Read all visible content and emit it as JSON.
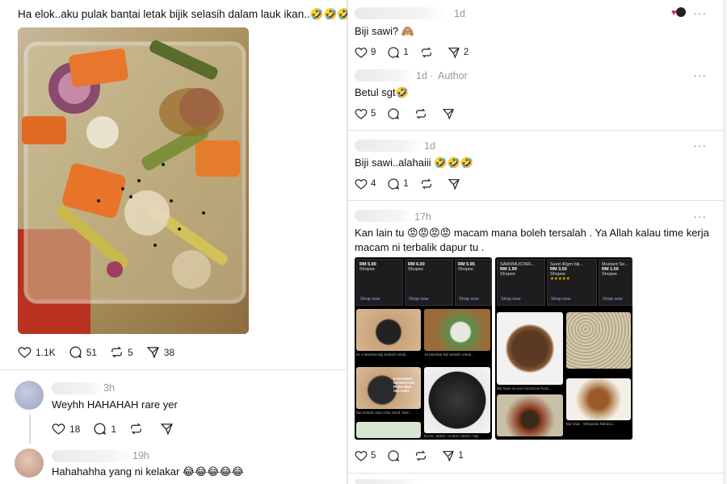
{
  "post": {
    "text": "Ha elok..aku pulak bantai letak bijik selasih dalam lauk ikan..🤣🤣🤣",
    "likes": "1.1K",
    "replies": "51",
    "reposts": "5",
    "shares": "38"
  },
  "left_replies": [
    {
      "time": "3h",
      "text": "Weyhh HAHAHAH rare yer",
      "likes": "18",
      "replies": "1"
    },
    {
      "time": "19h",
      "text": "Hahahahha yang ni kelakar 😂😂😂😂😂"
    }
  ],
  "right_comments": [
    {
      "time": "1d",
      "text": "Biji sawi? 🙈",
      "likes": "9",
      "replies": "1",
      "shares": "2"
    },
    {
      "time": "1d",
      "author_tag": "Author",
      "text": "Betul sgt🤣",
      "likes": "5"
    },
    {
      "time": "1d",
      "text": "Biji sawi..alahaiii 🤣🤣🤣",
      "likes": "4",
      "replies": "1"
    },
    {
      "time": "17h",
      "text_line1": "Kan lain tu 😡😡😡😡 macam mana boleh tersalah . Ya Allah kalau time kerja",
      "text_line2": "macam ni terbalik dapur tu .",
      "likes": "5",
      "shares": "1"
    }
  ],
  "screenshot1": {
    "prices": [
      "RM 5.90",
      "RM 6.00",
      "RM 5.95"
    ],
    "store": "Shopee",
    "shop_now": "Shop now",
    "captions": [
      "ini 4 Manfaat Biji Selasih untuk...",
      "15 Manfaat Biji Selasih untuk...",
      "Biji Selasih atau Chia Seed: Men...",
      "BASIL SEED / SABJA SEED / Biji..."
    ],
    "banner": "8 KHASIAT KESIHATAN PADA BIJI SELASIH"
  },
  "screenshot2": {
    "titles": [
      "SAWI/MUSTAR...",
      "Seed 40gm biji...",
      "Mustard Se..."
    ],
    "prices": [
      "RM 1.99",
      "RM 3.50",
      "RM 1.50"
    ],
    "store": "Shopee",
    "shop_now": "Shop now",
    "captions": [
      "Biji Sawi as your functional food...",
      "Biji Sawi - Wikipedia Bahasa..."
    ]
  },
  "colors": {
    "accent_red": "#e0245e",
    "meta_gray": "#9a9a9a"
  }
}
